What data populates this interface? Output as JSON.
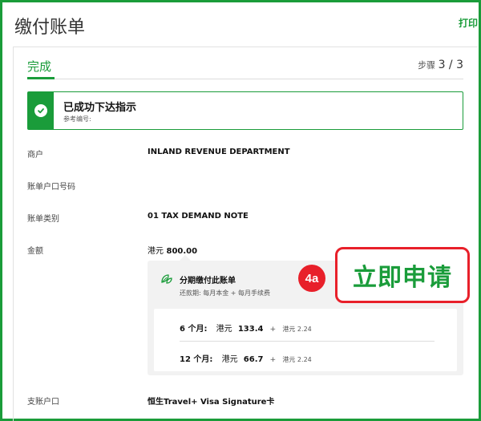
{
  "header": {
    "title": "缴付账单",
    "print_label": "打印"
  },
  "step": {
    "title": "完成",
    "prefix": "步骤",
    "counter": "3 / 3"
  },
  "success": {
    "title": "已成功下达指示",
    "reference_label": "参考编号:"
  },
  "details": {
    "merchant_label": "商户",
    "merchant_value": "INLAND REVENUE DEPARTMENT",
    "account_label": "账单户口号码",
    "type_label": "账单类别",
    "type_value": "01 TAX DEMAND NOTE",
    "amount_label": "金额",
    "amount_currency": "港元",
    "amount_value": "800.00",
    "pay_account_label": "支账户口",
    "pay_account_value": "恒生Travel+ Visa Signature卡"
  },
  "installment": {
    "title": "分期缴付此账单",
    "subtitle": "还款期: 每月本金 + 每月手续费",
    "plans": [
      {
        "label": "6 个月:",
        "currency": "港元",
        "amount": "133.4",
        "plus": "+",
        "fee": "港元 2.24"
      },
      {
        "label": "12 个月:",
        "currency": "港元",
        "amount": "66.7",
        "plus": "+",
        "fee": "港元 2.24"
      }
    ]
  },
  "annotation": {
    "badge": "4a",
    "apply_label": "立即申请"
  },
  "colors": {
    "brand_green": "#1a9c3a",
    "callout_red": "#e8202a"
  }
}
